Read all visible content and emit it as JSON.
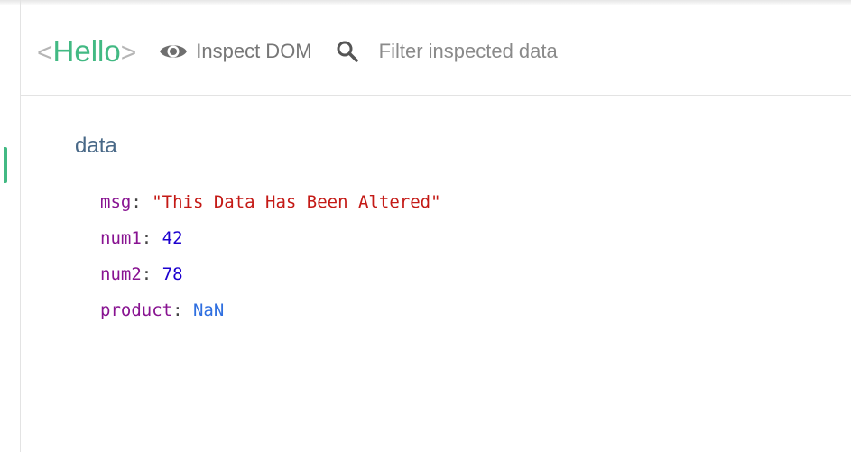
{
  "header": {
    "open_bracket": "<",
    "component_name": "Hello",
    "close_bracket": ">",
    "inspect_dom_label": "Inspect DOM",
    "filter_placeholder": "Filter inspected data",
    "filter_value": ""
  },
  "section": {
    "title": "data"
  },
  "properties": [
    {
      "key": "msg",
      "value": "\"This Data Has Been Altered\"",
      "type": "string"
    },
    {
      "key": "num1",
      "value": "42",
      "type": "number"
    },
    {
      "key": "num2",
      "value": "78",
      "type": "number"
    },
    {
      "key": "product",
      "value": "NaN",
      "type": "nan"
    }
  ],
  "colors": {
    "accent": "#42b983",
    "key": "#881391",
    "string": "#c41a16",
    "number": "#1c00cf",
    "section_title": "#486887"
  },
  "icons": {
    "inspect": "eye-icon",
    "filter": "search-icon"
  }
}
